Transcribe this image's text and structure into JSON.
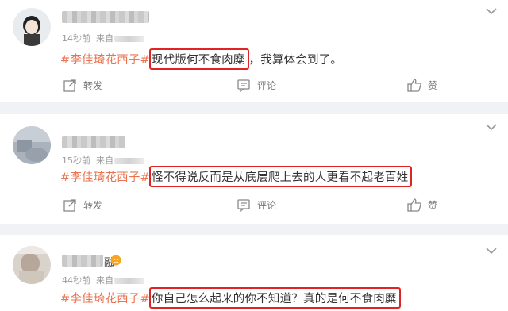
{
  "posts": [
    {
      "time": "14秒前",
      "source_prefix": "来自",
      "hashtag": "#李佳琦花西子#",
      "highlight": "现代版何不食肉糜",
      "rest": "，我算体会到了。",
      "actions": {
        "repost": "转发",
        "comment": "评论",
        "like": "赞"
      }
    },
    {
      "time": "15秒前",
      "source_prefix": "来自",
      "hashtag": "#李佳琦花西子#",
      "highlight": "怪不得说反而是从底层爬上去的人更看不起老百姓",
      "rest": "",
      "actions": {
        "repost": "转发",
        "comment": "评论",
        "like": "赞"
      }
    },
    {
      "time": "44秒前",
      "source_prefix": "来自",
      "name_suffix": "融",
      "hashtag": "#李佳琦花西子#",
      "highlight": "你自己怎么起来的你不知道？真的是何不食肉糜",
      "rest": ""
    }
  ],
  "colors": {
    "hashtag": "#eb7350",
    "highlight_border": "#e02323",
    "background": "#f1f2f5"
  },
  "icons": [
    "avatar",
    "chevron-down-icon",
    "repost-icon",
    "comment-icon",
    "like-icon",
    "vip-badge-icon"
  ]
}
